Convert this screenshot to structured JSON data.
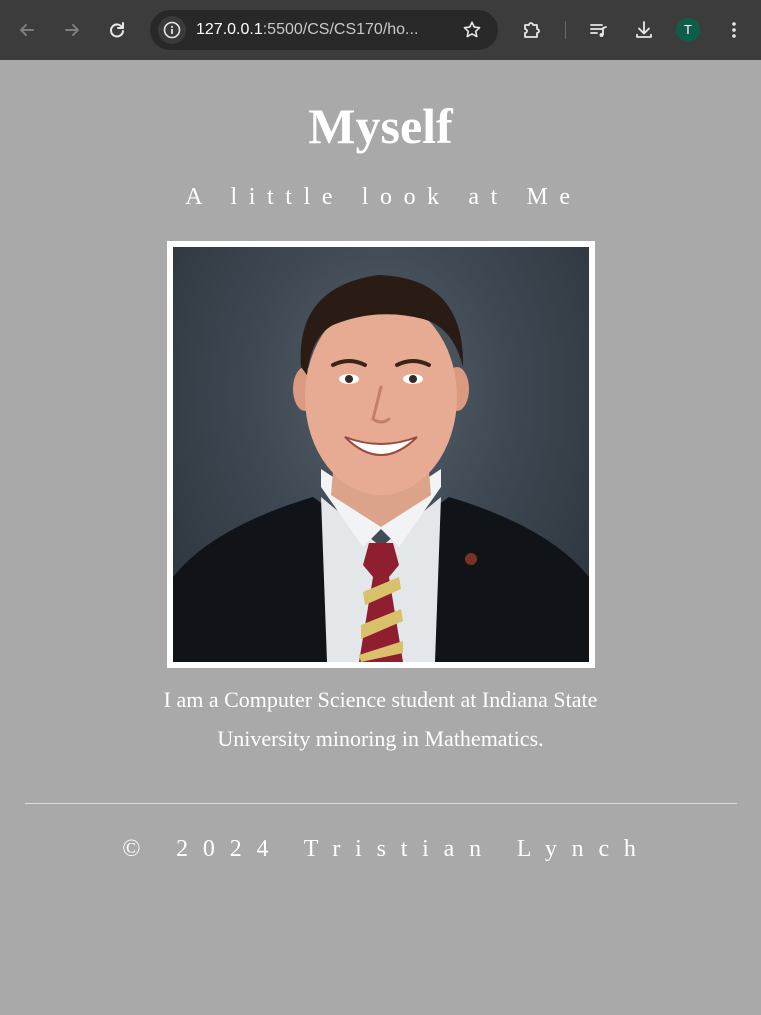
{
  "browser": {
    "url_host": "127.0.0.1",
    "url_rest": ":5500/CS/CS170/ho...",
    "profile_initial": "T",
    "icons": {
      "back": "arrow-left-icon",
      "forward": "arrow-right-icon",
      "reload": "reload-icon",
      "site_info": "info-icon",
      "bookmark": "star-icon",
      "extensions": "puzzle-icon",
      "media": "playlist-icon",
      "downloads": "download-icon",
      "menu": "kebab-menu-icon"
    },
    "colors": {
      "toolbar": "#3c3c3c",
      "omnibox": "#282828",
      "avatar": "#0f5c4b"
    }
  },
  "page": {
    "title": "Myself",
    "subtitle": "A little look at Me",
    "photo_alt": "Portrait photo",
    "bio": "I am a Computer Science student at Indiana State University minoring in Mathematics.",
    "footer": "© 2024 Tristian Lynch",
    "colors": {
      "background": "#a9a9a9",
      "text": "#ffffff",
      "frame": "#ffffff"
    }
  }
}
